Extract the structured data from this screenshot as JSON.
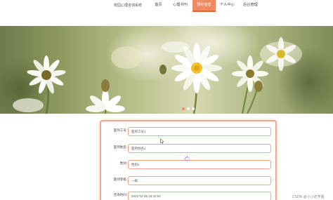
{
  "header": {
    "site_title": "校园心理咨询系统",
    "nav": [
      {
        "label": "首页",
        "active": false
      },
      {
        "label": "心理书刊",
        "active": false
      },
      {
        "label": "预约信息",
        "active": true
      },
      {
        "label": "个人中心",
        "active": false
      },
      {
        "label": "后台管理",
        "active": false
      }
    ]
  },
  "banner": {
    "slide_count": 3,
    "active_slide": 1
  },
  "form": {
    "fields": [
      {
        "label": "医师工号:",
        "value": "医师工号1"
      },
      {
        "label": "医师姓名:",
        "value": "医师姓名1"
      },
      {
        "label": "性别:",
        "value": "性别1"
      },
      {
        "label": "医师等级:",
        "value": "一级"
      },
      {
        "label": "咨询时间:",
        "value": "2022-02-26 16:42:54"
      }
    ]
  },
  "watermark": "CSDN @小小花学姐",
  "colors": {
    "accent": "#ef8a62",
    "accent_dark": "#e06535",
    "field_border": "#f2a288"
  }
}
